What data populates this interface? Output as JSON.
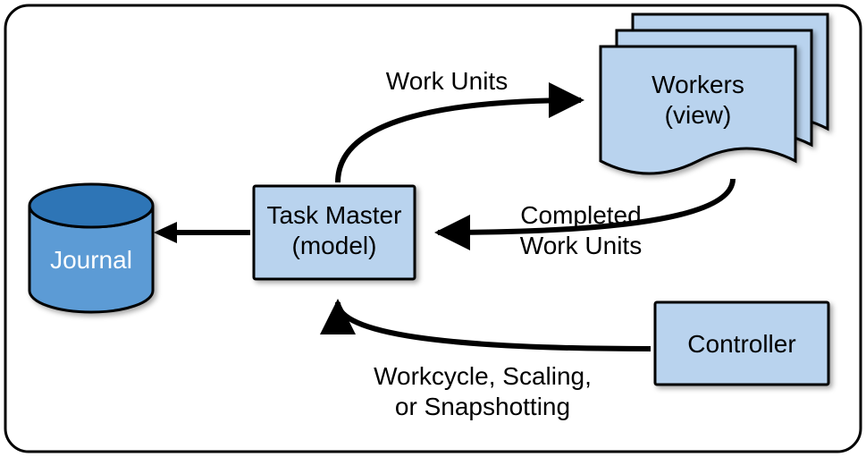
{
  "nodes": {
    "journal": {
      "label": "Journal"
    },
    "taskmaster": {
      "line1": "Task Master",
      "line2": "(model)"
    },
    "workers": {
      "line1": "Workers",
      "line2": "(view)"
    },
    "controller": {
      "label": "Controller"
    }
  },
  "edges": {
    "work_units": {
      "label": "Work Units"
    },
    "completed": {
      "line1": "Completed",
      "line2": "Work Units"
    },
    "workcycle": {
      "line1": "Workcycle, Scaling,",
      "line2": "or Snapshotting"
    }
  }
}
